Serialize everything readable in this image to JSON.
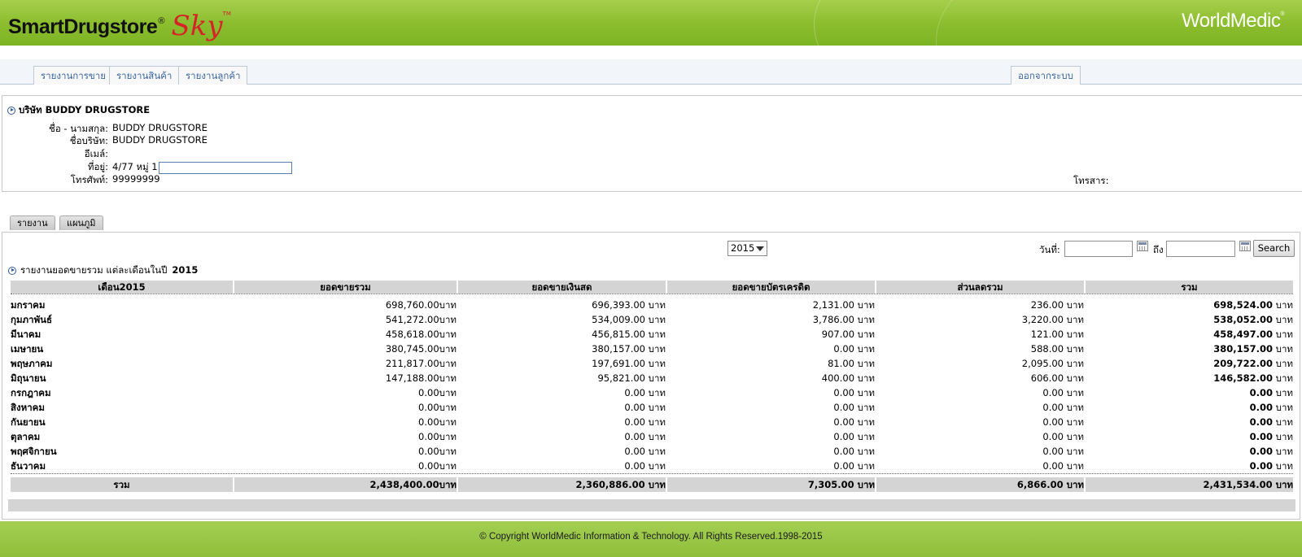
{
  "header": {
    "logo_main": "SmartDrugstore",
    "logo_reg": "®",
    "logo_sky": "Sky",
    "logo_tm": "TM",
    "brand_right": "WorldMedic",
    "brand_tm": "®"
  },
  "nav": {
    "tabs": [
      {
        "label": "รายงานการขาย"
      },
      {
        "label": "รายงานสินค้า"
      },
      {
        "label": "รายงานลูกค้า"
      }
    ],
    "logout_label": "ออกจากระบบ"
  },
  "company": {
    "title": "บริษัท BUDDY DRUGSTORE",
    "fields": [
      {
        "label": "ชื่อ - นามสกุล:",
        "value": "BUDDY DRUGSTORE"
      },
      {
        "label": "ชื่อบริษัท:",
        "value": "BUDDY DRUGSTORE"
      },
      {
        "label": "อีเมล์:",
        "value": ""
      },
      {
        "label": "ที่อยู่:",
        "value": "4/77 หมู่ 1"
      },
      {
        "label": "โทรศัพท์:",
        "value": "99999999"
      }
    ],
    "fax_label": "โทรสาร:"
  },
  "tabs": [
    {
      "label": "รายงาน"
    },
    {
      "label": "แผนภูมิ"
    }
  ],
  "filters": {
    "year": "2015",
    "date_from_label": "วันที่:",
    "date_to_label": "ถึง",
    "search_label": "Search"
  },
  "report": {
    "title": "รายงานยอดขายรวม แต่ละเดือนในปี",
    "year": "2015",
    "columns": [
      "เดือน2015",
      "ยอดขายรวม",
      "ยอดขายเงินสด",
      "ยอดขายบัตรเครดิต",
      "ส่วนลดรวม",
      "รวม"
    ],
    "rows": [
      {
        "month": "มกราคม",
        "total_sales": "698,760.00บาท",
        "cash": "696,393.00 บาท",
        "credit": "2,131.00 บาท",
        "discount": "236.00 บาท",
        "net_amount": "698,524.00",
        "net_unit": " บาท"
      },
      {
        "month": "กุมภาพันธ์",
        "total_sales": "541,272.00บาท",
        "cash": "534,009.00 บาท",
        "credit": "3,786.00 บาท",
        "discount": "3,220.00 บาท",
        "net_amount": "538,052.00",
        "net_unit": " บาท"
      },
      {
        "month": "มีนาคม",
        "total_sales": "458,618.00บาท",
        "cash": "456,815.00 บาท",
        "credit": "907.00 บาท",
        "discount": "121.00 บาท",
        "net_amount": "458,497.00",
        "net_unit": " บาท"
      },
      {
        "month": "เมษายน",
        "total_sales": "380,745.00บาท",
        "cash": "380,157.00 บาท",
        "credit": "0.00 บาท",
        "discount": "588.00 บาท",
        "net_amount": "380,157.00",
        "net_unit": " บาท"
      },
      {
        "month": "พฤษภาคม",
        "total_sales": "211,817.00บาท",
        "cash": "197,691.00 บาท",
        "credit": "81.00 บาท",
        "discount": "2,095.00 บาท",
        "net_amount": "209,722.00",
        "net_unit": " บาท"
      },
      {
        "month": "มิถุนายน",
        "total_sales": "147,188.00บาท",
        "cash": "95,821.00 บาท",
        "credit": "400.00 บาท",
        "discount": "606.00 บาท",
        "net_amount": "146,582.00",
        "net_unit": " บาท"
      },
      {
        "month": "กรกฎาคม",
        "total_sales": "0.00บาท",
        "cash": "0.00 บาท",
        "credit": "0.00 บาท",
        "discount": "0.00 บาท",
        "net_amount": "0.00",
        "net_unit": " บาท"
      },
      {
        "month": "สิงหาคม",
        "total_sales": "0.00บาท",
        "cash": "0.00 บาท",
        "credit": "0.00 บาท",
        "discount": "0.00 บาท",
        "net_amount": "0.00",
        "net_unit": " บาท"
      },
      {
        "month": "กันยายน",
        "total_sales": "0.00บาท",
        "cash": "0.00 บาท",
        "credit": "0.00 บาท",
        "discount": "0.00 บาท",
        "net_amount": "0.00",
        "net_unit": " บาท"
      },
      {
        "month": "ตุลาคม",
        "total_sales": "0.00บาท",
        "cash": "0.00 บาท",
        "credit": "0.00 บาท",
        "discount": "0.00 บาท",
        "net_amount": "0.00",
        "net_unit": " บาท"
      },
      {
        "month": "พฤศจิกายน",
        "total_sales": "0.00บาท",
        "cash": "0.00 บาท",
        "credit": "0.00 บาท",
        "discount": "0.00 บาท",
        "net_amount": "0.00",
        "net_unit": " บาท"
      },
      {
        "month": "ธันวาคม",
        "total_sales": "0.00บาท",
        "cash": "0.00 บาท",
        "credit": "0.00 บาท",
        "discount": "0.00 บาท",
        "net_amount": "0.00",
        "net_unit": " บาท"
      }
    ],
    "total_row": {
      "label": "รวม",
      "total_sales": "2,438,400.00บาท",
      "cash": "2,360,886.00 บาท",
      "credit": "7,305.00 บาท",
      "discount": "6,866.00 บาท",
      "net": "2,431,534.00 บาท"
    }
  },
  "footer": {
    "copyright": "© Copyright WorldMedic Information & Technology. All Rights Reserved.1998-2015"
  },
  "colors": {
    "header_green": "#8cbe2f",
    "brand_red": "#d6232a",
    "link_blue": "#3a66a3",
    "table_header_gray": "#d4d4d4"
  }
}
